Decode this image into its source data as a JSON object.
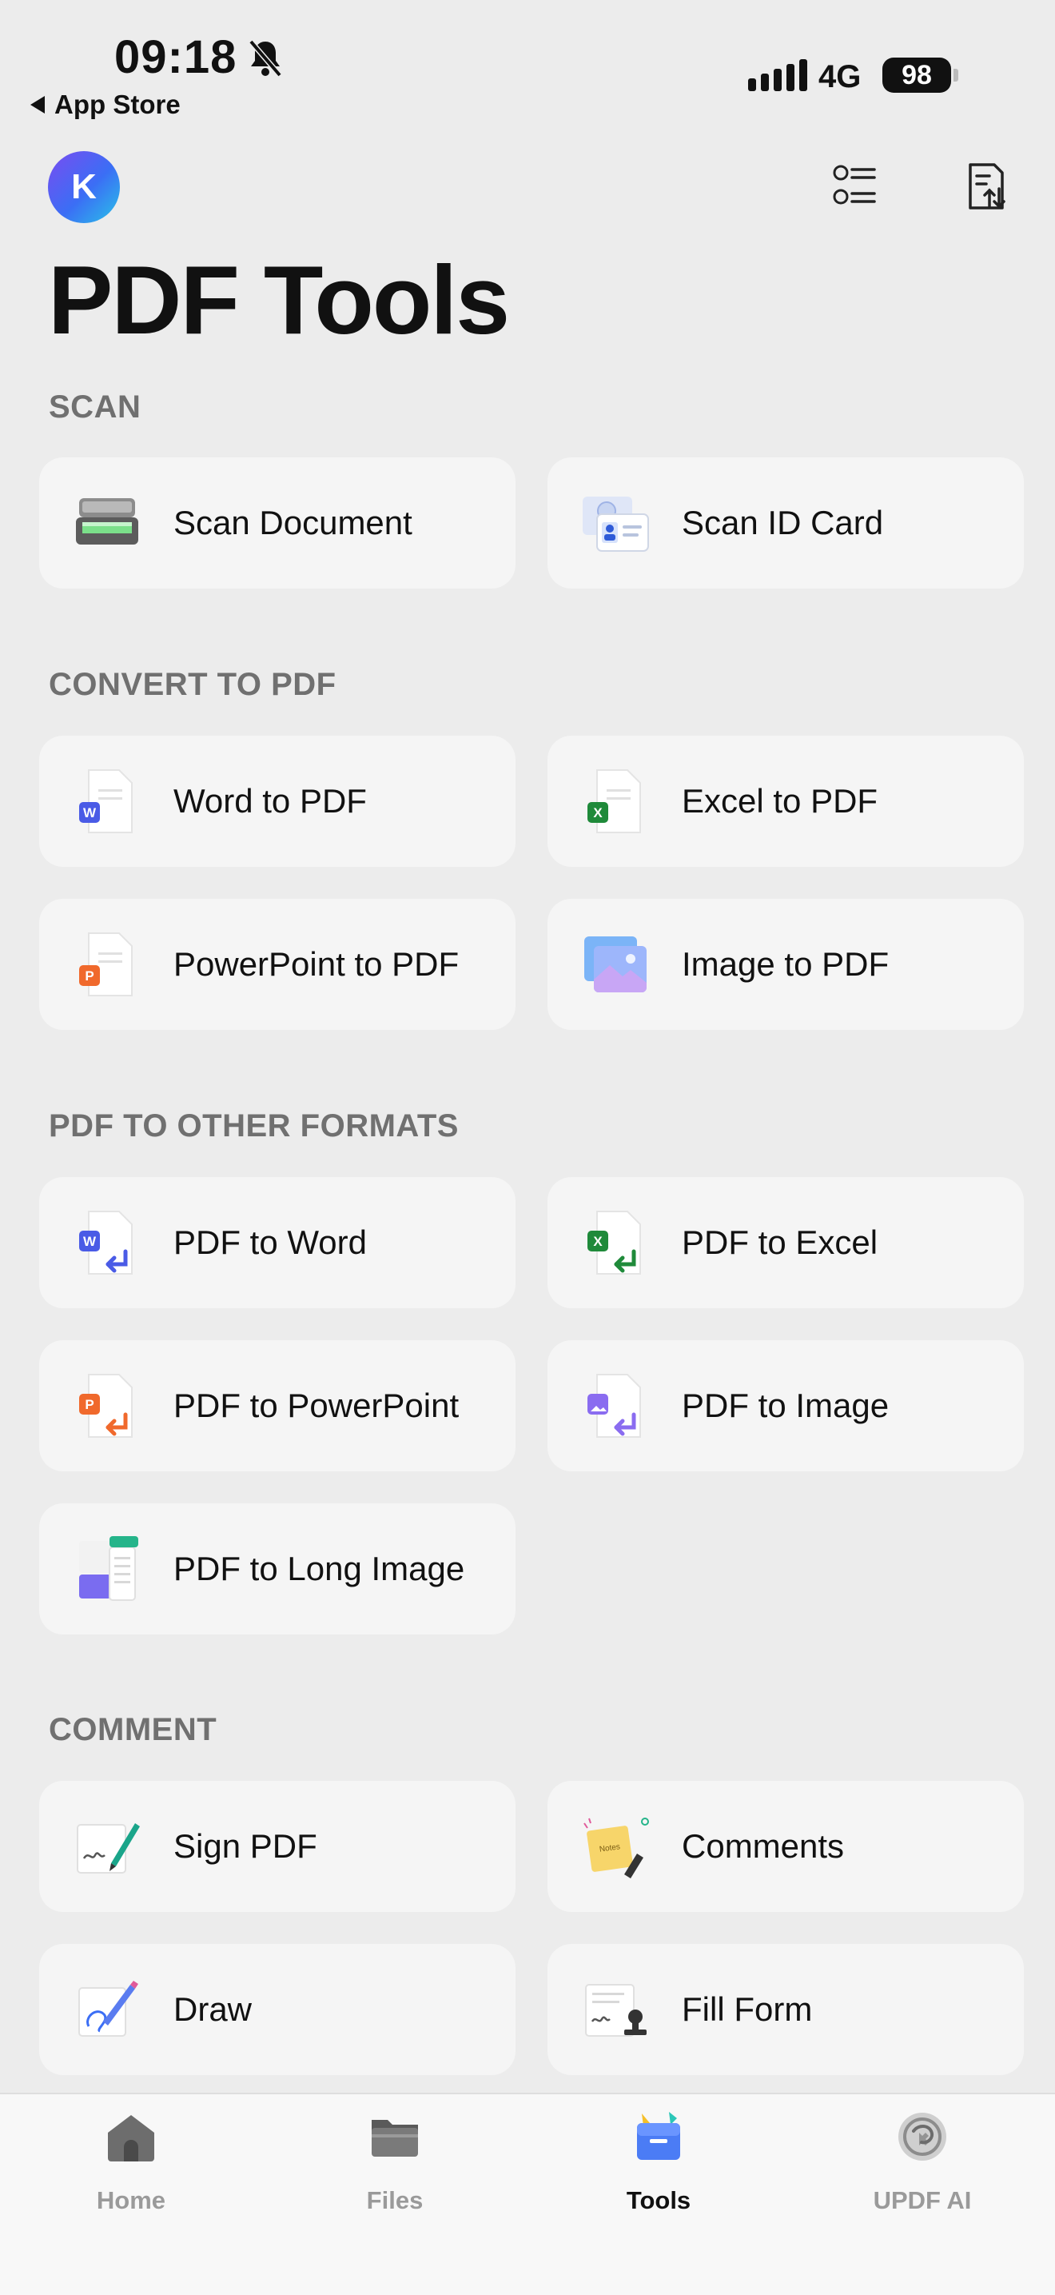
{
  "status_bar": {
    "time": "09:18",
    "back_app": "App Store",
    "network": "4G",
    "battery": "98"
  },
  "header": {
    "avatar_initial": "K",
    "title": "PDF Tools"
  },
  "sections": {
    "scan": "SCAN",
    "convert": "CONVERT TO PDF",
    "pdf_to_other": "PDF TO OTHER FORMATS",
    "comment": "COMMENT"
  },
  "tiles": {
    "scan_document": "Scan Document",
    "scan_id_card": "Scan ID Card",
    "word_to_pdf": "Word to PDF",
    "excel_to_pdf": "Excel to PDF",
    "powerpoint_to_pdf": "PowerPoint to PDF",
    "image_to_pdf": "Image to PDF",
    "pdf_to_word": "PDF to Word",
    "pdf_to_excel": "PDF to Excel",
    "pdf_to_powerpoint": "PDF to PowerPoint",
    "pdf_to_image": "PDF to Image",
    "pdf_to_long_image": "PDF to Long Image",
    "sign_pdf": "Sign PDF",
    "comments": "Comments",
    "draw": "Draw",
    "fill_form": "Fill Form"
  },
  "tab_bar": {
    "home": "Home",
    "files": "Files",
    "tools": "Tools",
    "updf_ai": "UPDF AI",
    "active": "Tools"
  },
  "colors": {
    "word": "#4a5be6",
    "excel": "#1f8a3a",
    "powerpoint": "#f0692c",
    "image": "#8a6cf0",
    "accent": "#3b6ef5"
  },
  "icons": {
    "status": [
      "bell-slash-icon",
      "signal-icon",
      "battery-icon"
    ],
    "header": [
      "list-view-icon",
      "sort-files-icon"
    ],
    "tabs": [
      "home-icon",
      "folder-icon",
      "toolbox-icon",
      "updf-ai-icon"
    ]
  }
}
